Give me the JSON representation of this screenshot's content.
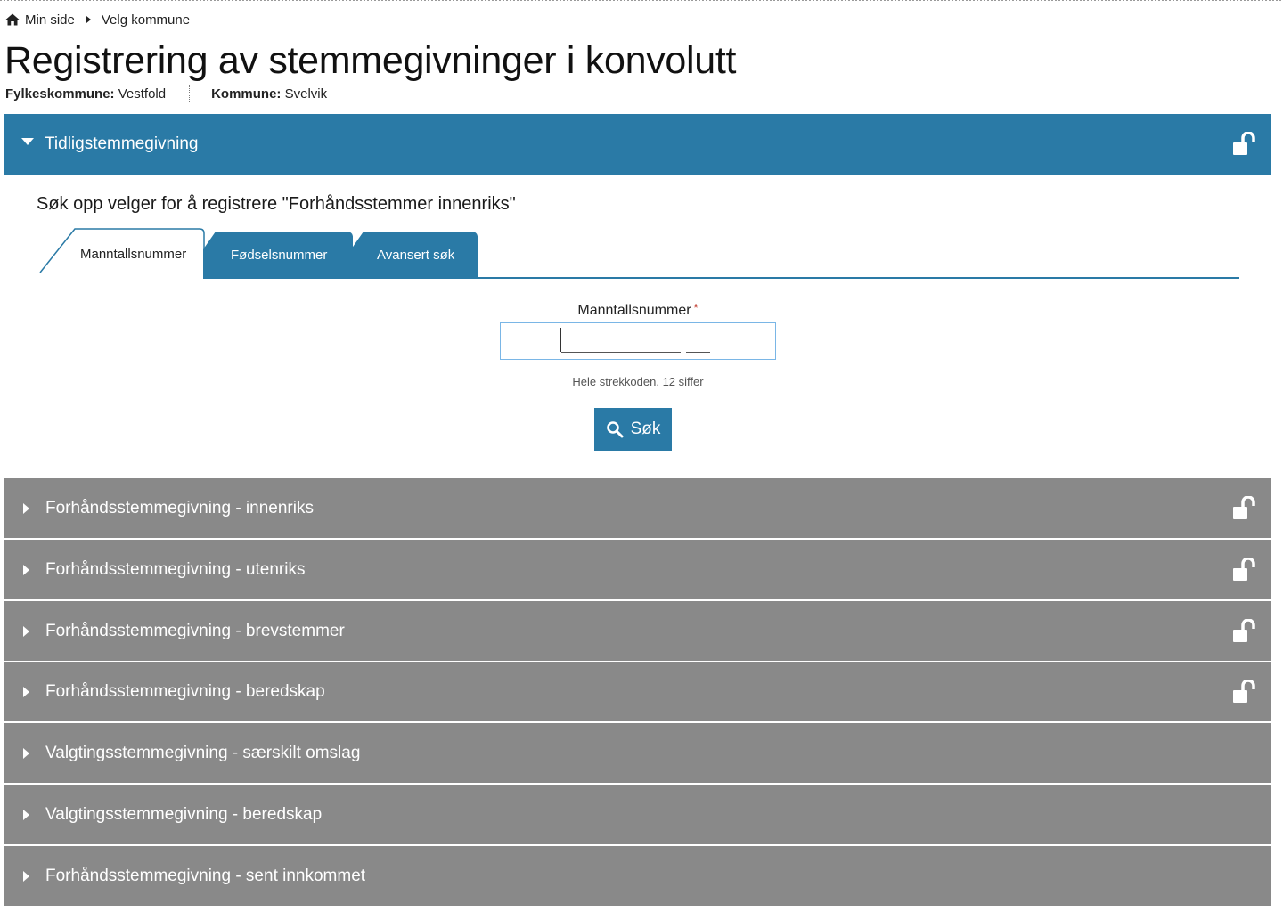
{
  "breadcrumb": {
    "home": "Min side",
    "current": "Velg kommune"
  },
  "page": {
    "title": "Registrering av stemmegivninger i konvolutt",
    "county_label": "Fylkeskommune:",
    "county_value": "Vestfold",
    "municipality_label": "Kommune:",
    "municipality_value": "Svelvik"
  },
  "active_panel": {
    "title": "Tidligstemmegivning",
    "search_heading": "Søk opp velger for å registrere \"Forhåndsstemmer innenriks\"",
    "tabs": [
      "Manntallsnummer",
      "Fødselsnummer",
      "Avansert søk"
    ],
    "selected_tab": "Manntallsnummer",
    "field_label": "Manntallsnummer",
    "required_marker": "*",
    "field_value": "",
    "hint": "Hele strekkoden, 12 siffer",
    "search_button": "Søk"
  },
  "panels": [
    {
      "title": "Forhåndsstemmegivning - innenriks",
      "lock": true
    },
    {
      "title": "Forhåndsstemmegivning - utenriks",
      "lock": true
    },
    {
      "title": "Forhåndsstemmegivning - brevstemmer",
      "lock": true
    },
    {
      "title": "Forhåndsstemmegivning - beredskap",
      "lock": true
    },
    {
      "title": "Valgtingsstemmegivning - særskilt omslag",
      "lock": false
    },
    {
      "title": "Valgtingsstemmegivning - beredskap",
      "lock": false
    },
    {
      "title": "Forhåndsstemmegivning - sent innkommet",
      "lock": false
    }
  ],
  "colors": {
    "accent": "#2a7aa6",
    "collapsed_panel": "#898989",
    "input_focus": "#7ab6e6",
    "required": "#c0392b"
  },
  "icons": {
    "home": "home-icon",
    "lock": "unlock-icon",
    "search": "search-icon"
  }
}
